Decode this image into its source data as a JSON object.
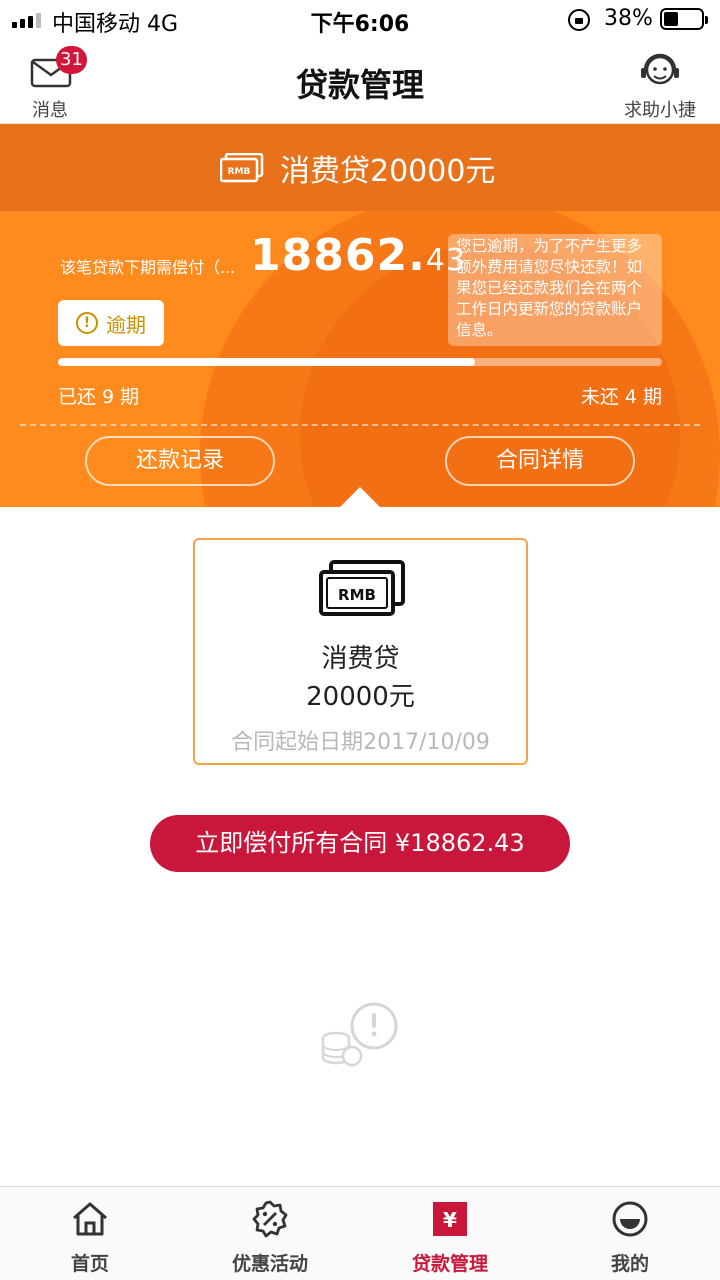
{
  "status_bar": {
    "carrier": "中国移动   4G",
    "time": "下午6:06",
    "battery_percent": "38%",
    "battery_level": 0.38
  },
  "nav": {
    "title": "贷款管理",
    "messages_label": "消息",
    "messages_badge": "31",
    "help_label": "求助小捷"
  },
  "loan": {
    "header_title": "消费贷20000元",
    "due_label": "该笔贷款下期需偿付（...",
    "due_amount_int": "18862.",
    "due_amount_dec": "43",
    "notice": "您已逾期，为了不产生更多额外费用请您尽快还款！如果您已经还款我们会在两个工作日内更新您的贷款账户信息。",
    "status_tag": "逾期",
    "paid_periods_label": "已还 9 期",
    "unpaid_periods_label": "未还 4 期",
    "progress_fraction": 0.69,
    "repay_record_button": "还款记录",
    "contract_detail_button": "合同详情"
  },
  "contract": {
    "icon_text": "RMB",
    "name": "消费贷",
    "amount": "20000元",
    "start_date": "合同起始日期2017/10/09"
  },
  "pay_all_button": "立即偿付所有合同 ¥18862.43",
  "tabs": [
    {
      "label": "首页",
      "icon": "home-icon"
    },
    {
      "label": "优惠活动",
      "icon": "discount-icon"
    },
    {
      "label": "贷款管理",
      "icon": "yuan-icon"
    },
    {
      "label": "我的",
      "icon": "profile-icon"
    }
  ],
  "colors": {
    "accent": "#c8173a",
    "orange": "#ff8a1e",
    "overdue": "#c99200"
  }
}
